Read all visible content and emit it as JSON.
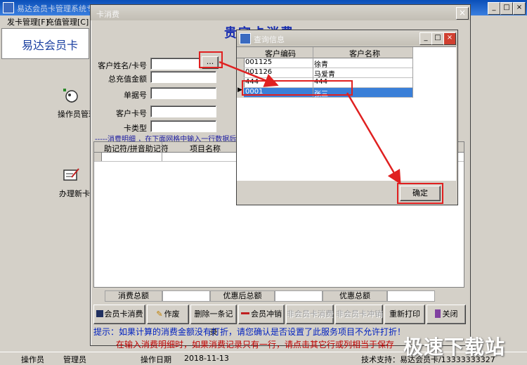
{
  "main_window": {
    "title": "易达会员卡管理系统专",
    "menu": [
      "发卡管理[F]",
      "充值管理[C]"
    ],
    "banner": "易达会员卡",
    "sidebar": [
      "操作员管理",
      "办理新卡"
    ],
    "status": {
      "operator_label": "操作员",
      "operator_value": "管理员",
      "date_label": "操作日期",
      "date_value": "2018-11-13",
      "support": "技术支持：易达会员卡/13333333327"
    }
  },
  "consume_dialog": {
    "title": "卡消费",
    "heading": "贵宾卡消费",
    "labels": {
      "customer_name": "客户姓名/卡号",
      "total_recharge": "总充值金额",
      "doc_no": "单据号",
      "card_no": "客户卡号",
      "card_type": "卡类型"
    },
    "browse_button": "...",
    "detail_hint": "-----消费明细   ，在下面网格中输入一行数据后",
    "grid_columns": [
      "助记符/拼音助记符",
      "项目名称"
    ],
    "summary": [
      "消费总额",
      "优惠后总额",
      "优惠总额"
    ],
    "buttons": [
      {
        "label": "会员卡消费",
        "icon": "save-icon",
        "enabled": true
      },
      {
        "label": "作废",
        "icon": "void-icon",
        "enabled": true
      },
      {
        "label": "删除一条记录",
        "icon": "",
        "enabled": true
      },
      {
        "label": "会员冲销",
        "icon": "minus-icon",
        "enabled": true
      },
      {
        "label": "非会员卡消费",
        "icon": "",
        "enabled": false
      },
      {
        "label": "非会员卡冲销",
        "icon": "",
        "enabled": false
      },
      {
        "label": "重新打印",
        "icon": "",
        "enabled": true
      },
      {
        "label": "关闭",
        "icon": "door-icon",
        "enabled": true
      }
    ],
    "tip1": "提示：如果计算的消费金额没有打折，请您确认是否设置了此服务项目不允许打折！",
    "tip2": "在输入消费明细时，如果消费记录只有一行，请点击其它行或列相当于保存"
  },
  "query_dialog": {
    "title": "查询信息",
    "columns": [
      "客户编码",
      "客户名称"
    ],
    "rows": [
      {
        "code": "001125",
        "name": "徐青",
        "selected": false
      },
      {
        "code": "001126",
        "name": "马爱青",
        "selected": false
      },
      {
        "code": "444",
        "name": "444",
        "selected": false
      },
      {
        "code": "0001",
        "name": "张三",
        "selected": true
      }
    ],
    "confirm_button": "确定"
  },
  "watermark": "极速下载站",
  "colors": {
    "annotation_red": "#e02020",
    "selection_blue": "#3a7fd8",
    "title_blue": "#1a2fb0"
  }
}
